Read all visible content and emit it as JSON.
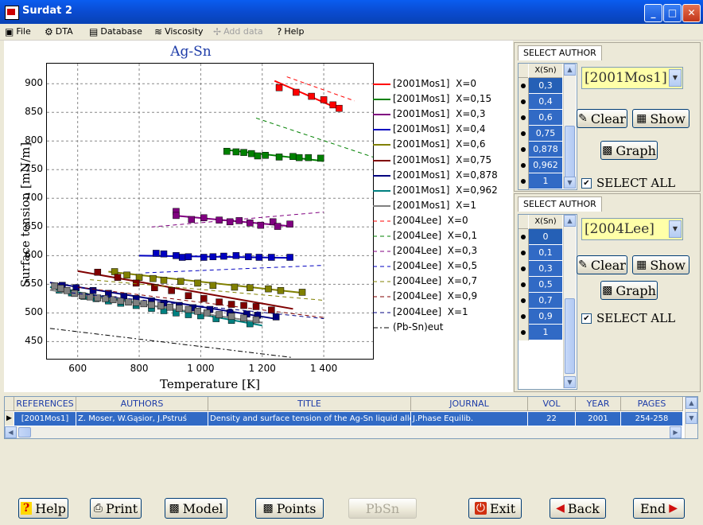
{
  "window": {
    "title": "Surdat 2",
    "controls": {
      "minimize": "_",
      "maximize": "□",
      "close": "✕"
    }
  },
  "menu": [
    {
      "label": "File",
      "icon": "folder-icon",
      "glyph": "▣",
      "disabled": false
    },
    {
      "label": "DTA",
      "icon": "dta-icon",
      "glyph": "⚙",
      "disabled": false
    },
    {
      "label": "Database",
      "icon": "database-icon",
      "glyph": "▤",
      "disabled": false
    },
    {
      "label": "Viscosity",
      "icon": "viscosity-icon",
      "glyph": "≋",
      "disabled": false
    },
    {
      "label": "Add data",
      "icon": "add-data-icon",
      "glyph": "✢",
      "disabled": true
    },
    {
      "label": "Help",
      "icon": "help-icon",
      "glyph": "?",
      "disabled": false
    }
  ],
  "chart_data": {
    "type": "scatter",
    "title": "Ag-Sn",
    "xlabel": "Temperature [K]",
    "ylabel": "Surface tension [mN/m]",
    "xlim": [
      500,
      1560
    ],
    "ylim": [
      420,
      935
    ],
    "xticks": [
      600,
      800,
      1000,
      1200,
      1400
    ],
    "xtick_labels": [
      "600",
      "800",
      "1 000",
      "1 200",
      "1 400"
    ],
    "yticks": [
      450,
      500,
      550,
      600,
      650,
      700,
      750,
      800,
      850,
      900
    ],
    "grid": true,
    "legend_position": "right",
    "series": [
      {
        "name": "[2001Mos1]  X=0",
        "color": "#ff0000",
        "style": "solid",
        "line": [
          [
            1240,
            905
          ],
          [
            1440,
            858
          ]
        ],
        "points": [
          [
            1255,
            893
          ],
          [
            1310,
            885
          ],
          [
            1360,
            878
          ],
          [
            1400,
            872
          ],
          [
            1430,
            863
          ],
          [
            1450,
            857
          ]
        ]
      },
      {
        "name": "[2001Mos1]  X=0,15",
        "color": "#008000",
        "style": "solid",
        "line": [
          [
            1075,
            785
          ],
          [
            1400,
            765
          ]
        ],
        "points": [
          [
            1085,
            782
          ],
          [
            1115,
            781
          ],
          [
            1140,
            780
          ],
          [
            1165,
            778
          ],
          [
            1185,
            774
          ],
          [
            1210,
            775
          ],
          [
            1255,
            772
          ],
          [
            1300,
            773
          ],
          [
            1320,
            771
          ],
          [
            1350,
            771
          ],
          [
            1390,
            770
          ]
        ]
      },
      {
        "name": "[2001Mos1]  X=0,3",
        "color": "#800080",
        "style": "solid",
        "line": [
          [
            910,
            670
          ],
          [
            1300,
            651
          ]
        ],
        "points": [
          [
            920,
            677
          ],
          [
            920,
            670
          ],
          [
            970,
            663
          ],
          [
            1010,
            666
          ],
          [
            1060,
            662
          ],
          [
            1095,
            659
          ],
          [
            1125,
            661
          ],
          [
            1160,
            657
          ],
          [
            1195,
            653
          ],
          [
            1235,
            659
          ],
          [
            1250,
            651
          ],
          [
            1290,
            655
          ]
        ]
      },
      {
        "name": "[2001Mos1]  X=0,4",
        "color": "#0000c0",
        "style": "solid",
        "line": [
          [
            800,
            600
          ],
          [
            1300,
            596
          ]
        ],
        "points": [
          [
            855,
            604
          ],
          [
            880,
            603
          ],
          [
            920,
            600
          ],
          [
            940,
            597
          ],
          [
            960,
            598
          ],
          [
            1010,
            597
          ],
          [
            1040,
            598
          ],
          [
            1075,
            599
          ],
          [
            1115,
            600
          ],
          [
            1155,
            598
          ],
          [
            1190,
            597
          ],
          [
            1230,
            597
          ],
          [
            1290,
            597
          ]
        ]
      },
      {
        "name": "[2001Mos1]  X=0,6",
        "color": "#808000",
        "style": "solid",
        "line": [
          [
            700,
            572
          ],
          [
            1330,
            535
          ]
        ],
        "points": [
          [
            720,
            572
          ],
          [
            760,
            566
          ],
          [
            800,
            562
          ],
          [
            845,
            560
          ],
          [
            880,
            557
          ],
          [
            935,
            555
          ],
          [
            990,
            552
          ],
          [
            1040,
            548
          ],
          [
            1110,
            545
          ],
          [
            1160,
            544
          ],
          [
            1220,
            542
          ],
          [
            1260,
            539
          ],
          [
            1330,
            536
          ]
        ]
      },
      {
        "name": "[2001Mos1]  X=0,75",
        "color": "#800000",
        "style": "solid",
        "line": [
          [
            600,
            573
          ],
          [
            1300,
            507
          ]
        ],
        "points": [
          [
            665,
            571
          ],
          [
            730,
            562
          ],
          [
            790,
            552
          ],
          [
            850,
            544
          ],
          [
            905,
            539
          ],
          [
            960,
            530
          ],
          [
            1010,
            525
          ],
          [
            1060,
            519
          ],
          [
            1100,
            515
          ],
          [
            1140,
            513
          ],
          [
            1180,
            511
          ],
          [
            1230,
            505
          ]
        ]
      },
      {
        "name": "[2001Mos1]  X=0,878",
        "color": "#000080",
        "style": "solid",
        "line": [
          [
            510,
            553
          ],
          [
            1240,
            490
          ]
        ],
        "points": [
          [
            550,
            548
          ],
          [
            595,
            544
          ],
          [
            650,
            539
          ],
          [
            700,
            534
          ],
          [
            750,
            529
          ],
          [
            790,
            525
          ],
          [
            840,
            521
          ],
          [
            880,
            517
          ],
          [
            930,
            513
          ],
          [
            975,
            509
          ],
          [
            1030,
            506
          ],
          [
            1095,
            500
          ],
          [
            1150,
            498
          ],
          [
            1185,
            496
          ],
          [
            1245,
            493
          ]
        ]
      },
      {
        "name": "[2001Mos1]  X=0,962",
        "color": "#008080",
        "style": "solid",
        "line": [
          [
            510,
            545
          ],
          [
            1200,
            478
          ]
        ],
        "points": [
          [
            540,
            540
          ],
          [
            580,
            535
          ],
          [
            620,
            529
          ],
          [
            660,
            525
          ],
          [
            700,
            521
          ],
          [
            740,
            517
          ],
          [
            790,
            513
          ],
          [
            840,
            508
          ],
          [
            880,
            504
          ],
          [
            920,
            500
          ],
          [
            960,
            497
          ],
          [
            1000,
            495
          ],
          [
            1050,
            490
          ],
          [
            1100,
            487
          ],
          [
            1160,
            481
          ]
        ]
      },
      {
        "name": "[2001Mos1]  X=1",
        "color": "#808080",
        "style": "solid",
        "line": [
          [
            510,
            540
          ],
          [
            1200,
            483
          ]
        ],
        "points": [
          [
            525,
            547
          ],
          [
            545,
            543
          ],
          [
            565,
            539
          ],
          [
            590,
            534
          ],
          [
            615,
            530
          ],
          [
            640,
            528
          ],
          [
            665,
            526
          ],
          [
            690,
            525
          ],
          [
            715,
            523
          ],
          [
            740,
            521
          ],
          [
            765,
            519
          ],
          [
            790,
            518
          ],
          [
            815,
            516
          ],
          [
            840,
            514
          ],
          [
            870,
            512
          ],
          [
            900,
            510
          ],
          [
            930,
            508
          ],
          [
            960,
            506
          ],
          [
            990,
            503
          ],
          [
            1020,
            500
          ],
          [
            1060,
            497
          ],
          [
            1100,
            494
          ],
          [
            1140,
            491
          ],
          [
            1180,
            488
          ]
        ]
      },
      {
        "name": "[2004Lee]  X=0",
        "color": "#ff0000",
        "style": "dashed",
        "line": [
          [
            1280,
            912
          ],
          [
            1500,
            870
          ]
        ],
        "points": []
      },
      {
        "name": "[2004Lee]  X=0,1",
        "color": "#008000",
        "style": "dashed",
        "line": [
          [
            1180,
            840
          ],
          [
            1560,
            772
          ]
        ],
        "points": []
      },
      {
        "name": "[2004Lee]  X=0,3",
        "color": "#800080",
        "style": "dashed",
        "line": [
          [
            840,
            650
          ],
          [
            1400,
            676
          ]
        ],
        "points": []
      },
      {
        "name": "[2004Lee]  X=0,5",
        "color": "#0000c0",
        "style": "dashed",
        "line": [
          [
            820,
            570
          ],
          [
            1400,
            583
          ]
        ],
        "points": []
      },
      {
        "name": "[2004Lee]  X=0,7",
        "color": "#808000",
        "style": "dashed",
        "line": [
          [
            640,
            558
          ],
          [
            1400,
            522
          ]
        ],
        "points": []
      },
      {
        "name": "[2004Lee]  X=0,9",
        "color": "#800000",
        "style": "dashed",
        "line": [
          [
            600,
            545
          ],
          [
            1400,
            492
          ]
        ],
        "points": []
      },
      {
        "name": "[2004Lee]  X=1",
        "color": "#000080",
        "style": "dashed",
        "line": [
          [
            580,
            535
          ],
          [
            1400,
            490
          ]
        ],
        "points": []
      },
      {
        "name": "(Pb-Sn)eut",
        "color": "#000000",
        "style": "dashdot",
        "line": [
          [
            510,
            473
          ],
          [
            1300,
            422
          ]
        ],
        "points": []
      }
    ]
  },
  "panel1": {
    "tab": "SELECT AUTHOR",
    "col_header": "X(Sn)",
    "values": [
      "0,3",
      "0,4",
      "0,6",
      "0,75",
      "0,878",
      "0,962",
      "1"
    ],
    "author": "[2001Mos1]",
    "clear": "Clear",
    "show": "Show",
    "graph": "Graph",
    "select_all": "SELECT ALL"
  },
  "panel2": {
    "tab": "SELECT AUTHOR",
    "col_header": "X(Sn)",
    "values": [
      "0",
      "0,1",
      "0,3",
      "0,5",
      "0,7",
      "0,9",
      "1"
    ],
    "author": "[2004Lee]",
    "clear": "Clear",
    "show": "Show",
    "graph": "Graph",
    "select_all": "SELECT ALL"
  },
  "references": {
    "headers": [
      "REFERENCES",
      "AUTHORS",
      "TITLE",
      "JOURNAL",
      "VOL",
      "YEAR",
      "PAGES"
    ],
    "row": [
      "[2001Mos1]",
      "Z. Moser, W.Gąsior, J.Pstruś",
      "Density and surface tension of the Ag-Sn liquid alloys",
      "J.Phase Equilib.",
      "22",
      "2001",
      "254-258"
    ]
  },
  "buttons": {
    "help": "Help",
    "print": "Print",
    "model": "Model",
    "points": "Points",
    "pbsn": "PbSn",
    "exit": "Exit",
    "back": "Back",
    "end": "End"
  }
}
